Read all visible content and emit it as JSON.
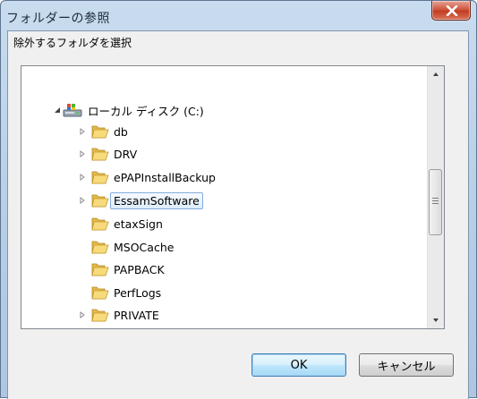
{
  "window": {
    "title": "フォルダーの参照"
  },
  "dialog": {
    "description": "除外するフォルダを選択"
  },
  "tree": {
    "drive_label": "ローカル ディスク (C:)",
    "items": [
      {
        "label": "db",
        "expandable": true
      },
      {
        "label": "DRV",
        "expandable": true
      },
      {
        "label": "ePAPInstallBackup",
        "expandable": true
      },
      {
        "label": "EssamSoftware",
        "expandable": true,
        "selected": true
      },
      {
        "label": "etaxSign",
        "expandable": false
      },
      {
        "label": "MSOCache",
        "expandable": false
      },
      {
        "label": "PAPBACK",
        "expandable": false
      },
      {
        "label": "PerfLogs",
        "expandable": false
      },
      {
        "label": "PRIVATE",
        "expandable": true
      }
    ]
  },
  "buttons": {
    "ok": "OK",
    "cancel": "キャンセル"
  },
  "colors": {
    "selection_border": "#84acdd",
    "title_bar": "#b6cde6",
    "close_button": "#c23c22"
  }
}
